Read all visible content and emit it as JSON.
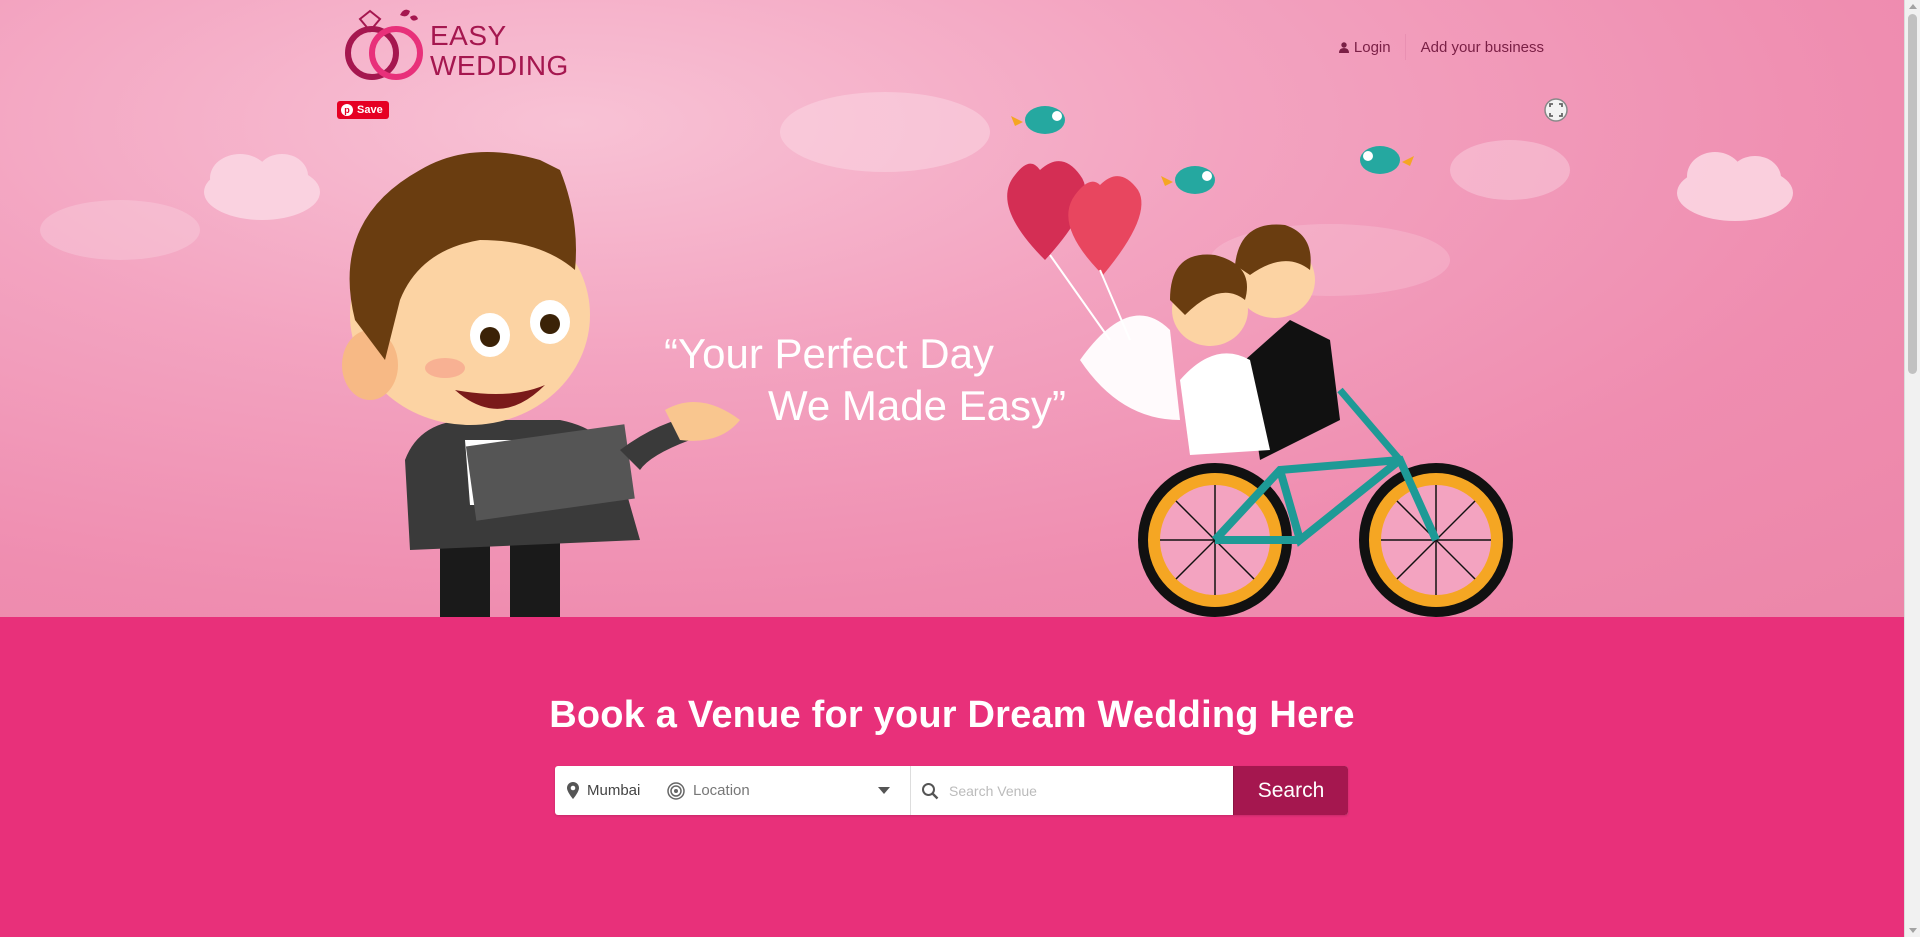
{
  "brand": {
    "line1": "EASY",
    "line2": "WEDDING"
  },
  "nav": {
    "login": "Login",
    "add_business": "Add your business"
  },
  "pinterest": {
    "save_label": "Save"
  },
  "hero": {
    "quote_line1": "“Your Perfect Day",
    "quote_line2": "We Made Easy”"
  },
  "main": {
    "headline": "Book a Venue for your Dream Wedding Here"
  },
  "search": {
    "city_value": "Mumbai",
    "location_placeholder": "Location",
    "venue_placeholder": "Search Venue",
    "button_label": "Search"
  },
  "colors": {
    "brand": "#a5174f",
    "accent": "#e8307a",
    "hero_pink": "#f3a3c0"
  },
  "icons": [
    "user-icon",
    "map-pin-icon",
    "target-icon",
    "search-icon",
    "pinterest-icon",
    "expand-icon",
    "chevron-down-icon"
  ]
}
